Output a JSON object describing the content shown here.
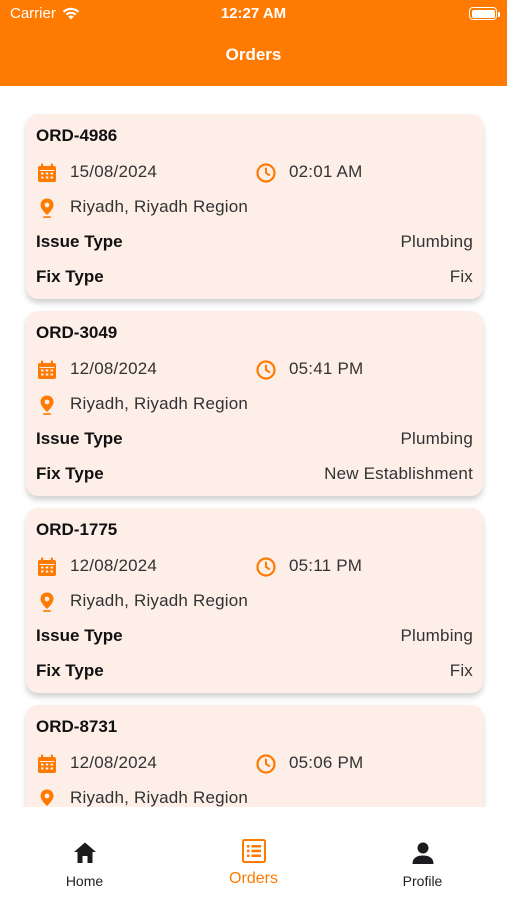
{
  "status_bar": {
    "carrier": "Carrier",
    "time": "12:27 AM"
  },
  "header": {
    "title": "Orders"
  },
  "colors": {
    "accent": "#ff7a00",
    "card_bg": "#fdeee7"
  },
  "labels": {
    "issue_type": "Issue Type",
    "fix_type": "Fix Type"
  },
  "orders": [
    {
      "id": "ORD-4986",
      "date": "15/08/2024",
      "time": "02:01 AM",
      "location": "Riyadh, Riyadh Region",
      "issue_type": "Plumbing",
      "fix_type": "Fix"
    },
    {
      "id": "ORD-3049",
      "date": "12/08/2024",
      "time": "05:41 PM",
      "location": "Riyadh, Riyadh Region",
      "issue_type": "Plumbing",
      "fix_type": "New Establishment"
    },
    {
      "id": "ORD-1775",
      "date": "12/08/2024",
      "time": "05:11 PM",
      "location": "Riyadh, Riyadh Region",
      "issue_type": "Plumbing",
      "fix_type": "Fix"
    },
    {
      "id": "ORD-8731",
      "date": "12/08/2024",
      "time": "05:06 PM",
      "location": "Riyadh, Riyadh Region",
      "issue_type": "",
      "fix_type": ""
    }
  ],
  "tabs": [
    {
      "label": "Home",
      "icon": "home-icon",
      "active": false
    },
    {
      "label": "Orders",
      "icon": "orders-icon",
      "active": true
    },
    {
      "label": "Profile",
      "icon": "profile-icon",
      "active": false
    }
  ]
}
